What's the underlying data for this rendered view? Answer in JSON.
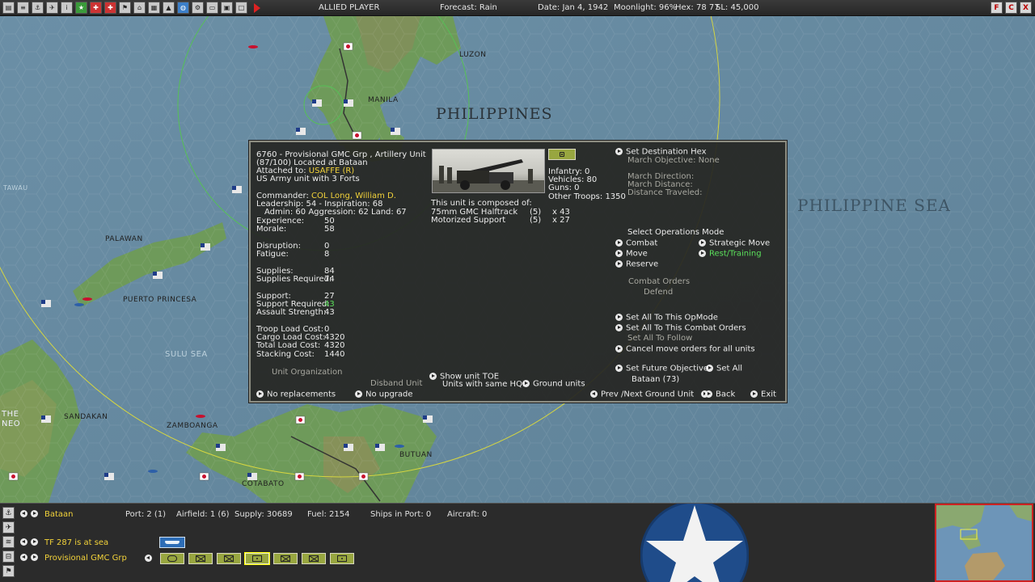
{
  "topbar": {
    "player": "ALLIED PLAYER",
    "forecast": "Forecast: Rain",
    "date": "Date: Jan 4, 1942",
    "moonlight": "Moonlight: 96%",
    "hex": "Hex: 78 77",
    "sl": "SL: 45,000",
    "right_buttons": [
      "F",
      "C",
      "X"
    ]
  },
  "map": {
    "labels": {
      "luzon": "LUZON",
      "manila": "MANILA",
      "philippines": "PHILIPPINES",
      "philippine_sea": "PHILIPPINE SEA",
      "palawan": "PALAWAN",
      "puerto_princesa": "PUERTO PRINCESA",
      "sulu_sea": "SULU SEA",
      "sandakan": "SANDAKAN",
      "zamboanga": "ZAMBOANGA",
      "butuan": "BUTUAN",
      "cotabato": "COTABATO",
      "tawau": "TAWAU",
      "borneo_frag": "THE\nNEO"
    }
  },
  "unit": {
    "title": "6760 - Provisional GMC Grp , Artillery Unit",
    "location": "(87/100) Located at Bataan",
    "attached_label": "Attached to:",
    "attached_value": "USAFFE (R)",
    "type_desc": "US Army unit with 3 Forts",
    "commander_label": "Commander:",
    "commander_value": "COL Long, William D.",
    "leadership": "Leadership: 54 - Inspiration: 68",
    "admin": "Admin: 60  Aggression: 62  Land: 67",
    "stats": [
      {
        "label": "Experience:",
        "value": "50"
      },
      {
        "label": "Morale:",
        "value": "58"
      },
      {
        "label": "Disruption:",
        "value": "0"
      },
      {
        "label": "Fatigue:",
        "value": "8"
      },
      {
        "label": "Supplies:",
        "value": "84"
      },
      {
        "label": "Supplies Required:",
        "value": "74"
      },
      {
        "label": "Support:",
        "value": "27"
      },
      {
        "label": "Support Required:",
        "value": "43"
      },
      {
        "label": "Assault Strength:",
        "value": "43"
      },
      {
        "label": "Troop Load Cost:",
        "value": "0"
      },
      {
        "label": "Cargo Load Cost:",
        "value": "4320"
      },
      {
        "label": "Total Load Cost:",
        "value": "4320"
      },
      {
        "label": "Stacking Cost:",
        "value": "1440"
      }
    ],
    "unit_org": "Unit Organization",
    "no_replacements": "No replacements",
    "disband_unit": "Disband Unit",
    "no_upgrade": "No upgrade",
    "troops": [
      "Infantry: 0",
      "Vehicles: 80",
      "Guns: 0",
      "Other Troops: 1350"
    ],
    "composed_header": "This unit is composed of:",
    "devices": [
      {
        "name": "75mm GMC Halftrack",
        "qty": "(5)",
        "count": "x 43"
      },
      {
        "name": "Motorized Support",
        "qty": "(5)",
        "count": "x 27"
      }
    ],
    "show_toe": "Show unit TOE",
    "same_hq": "Units with same HQ:",
    "ground_units": "Ground units",
    "set_destination": "Set Destination Hex",
    "march_objective": "March Objective: None",
    "march_direction": "March Direction:",
    "march_distance": "March Distance:",
    "distance_traveled": "Distance Traveled:",
    "select_ops": "Select Operations Mode",
    "ops_modes": {
      "combat": "Combat",
      "move": "Move",
      "reserve": "Reserve",
      "strategic": "Strategic Move",
      "rest": "Rest/Training"
    },
    "combat_orders": "Combat Orders",
    "defend": "Defend",
    "set_all_opmode": "Set All To This OpMode",
    "set_all_combat": "Set All To This Combat Orders",
    "set_all_follow": "Set All To Follow",
    "cancel_move": "Cancel move orders for all units",
    "set_future": "Set Future Objective",
    "set_all": "Set All",
    "future_obj": "Bataan (73)",
    "prev_next": "Prev /Next Ground Unit",
    "back": "Back",
    "exit": "Exit"
  },
  "bottombar": {
    "base": "Bataan",
    "port": "Port: 2 (1)",
    "airfield": "Airfield: 1 (6)",
    "supply": "Supply: 30689",
    "fuel": "Fuel: 2154",
    "ships_in_port": "Ships in Port: 0",
    "aircraft": "Aircraft: 0",
    "tf": "TF 287 is at sea",
    "unit": "Provisional GMC Grp"
  },
  "colors": {
    "highlight_yellow": "#f2d23a",
    "highlight_green": "#5be05b",
    "infantry_unit": "#98a640",
    "us_flag_red": "#c8102e"
  }
}
